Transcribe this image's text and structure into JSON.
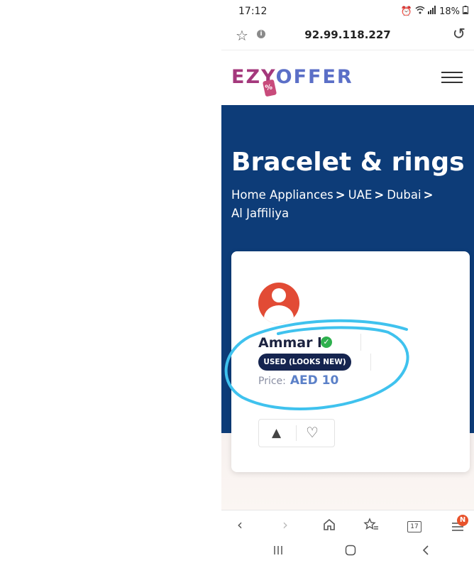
{
  "status_bar": {
    "time": "17:12",
    "battery": "18%"
  },
  "browser": {
    "url": "92.99.118.227"
  },
  "site": {
    "logo_part1": "EZY",
    "logo_part2": "OFFER",
    "logo_tag_glyph": "%"
  },
  "hero": {
    "title": "Bracelet & rings",
    "breadcrumb": [
      "Home Appliances",
      "UAE",
      "Dubai",
      "Al Jaffiliya"
    ],
    "separator": ">"
  },
  "listing": {
    "seller_name": "Ammar l",
    "condition": "USED (LOOKS NEW)",
    "price_label": "Price:",
    "price_value": "AED 10"
  },
  "toolbar": {
    "tab_count": "17",
    "menu_badge": "N"
  },
  "icons": {
    "star": "star-outline-icon",
    "info": "info-icon",
    "reload": "reload-icon",
    "menu": "hamburger-menu-icon",
    "verified": "verified-check-icon",
    "warning": "warning-icon",
    "heart": "heart-outline-icon"
  },
  "colors": {
    "hero_bg": "#0d3c78",
    "logo_primary": "#a4387c",
    "logo_secondary": "#5b6fc7",
    "avatar": "#e24b35",
    "verified": "#2eb04e",
    "condition_badge": "#15244f",
    "price": "#5b80c8",
    "scribble": "#3fc2ee"
  }
}
